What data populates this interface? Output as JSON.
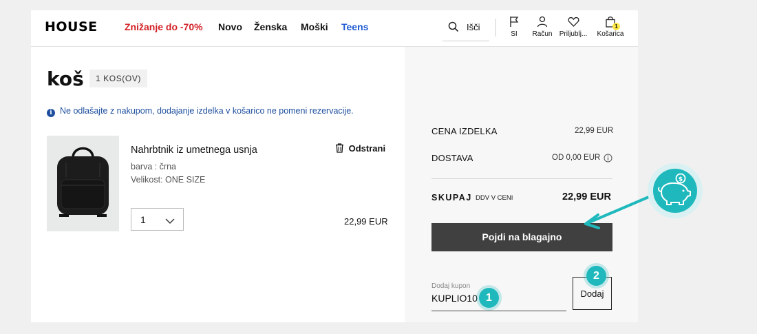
{
  "header": {
    "logo": "HOUSE",
    "nav": [
      {
        "label": "Znižanje do -70%",
        "color": "#d32026"
      },
      {
        "label": "Novo",
        "color": "#111111"
      },
      {
        "label": "Ženska",
        "color": "#111111"
      },
      {
        "label": "Moški",
        "color": "#111111"
      },
      {
        "label": "Teens",
        "color": "#1f5bd3"
      }
    ],
    "search_label": "Išči",
    "icons": [
      {
        "icon": "flag-icon",
        "label": "SI"
      },
      {
        "icon": "user-icon",
        "label": "Račun"
      },
      {
        "icon": "heart-icon",
        "label": "Priljublj..."
      },
      {
        "icon": "bag-icon",
        "label": "Košarica"
      }
    ],
    "cart_count": "1"
  },
  "cart": {
    "title": "koš",
    "items_count": "1 KOS(OV)",
    "notice": "Ne odlašajte z nakupom, dodajanje izdelka v košarico ne pomeni rezervacije.",
    "item": {
      "name": "Nahrbtnik iz umetnega usnja",
      "color_attr": "barva : črna",
      "size_attr": "Velikost: ONE SIZE",
      "quantity": "1",
      "price": "22,99 EUR",
      "remove_label": "Odstrani"
    }
  },
  "summary": {
    "product_price_label": "CENA IZDELKA",
    "product_price_value": "22,99 EUR",
    "shipping_label": "DOSTAVA",
    "shipping_value": "OD 0,00 EUR",
    "total_label": "SKUPAJ",
    "total_vat_note": "DDV V CENI",
    "total_value": "22,99 EUR",
    "checkout_label": "Pojdi na blagajno",
    "coupon_label": "Dodaj kupon",
    "coupon_value": "KUPLIO10",
    "add_label": "Dodaj"
  },
  "annotations": {
    "step1": "1",
    "step2": "2",
    "accent_color": "#1fb9bd"
  }
}
